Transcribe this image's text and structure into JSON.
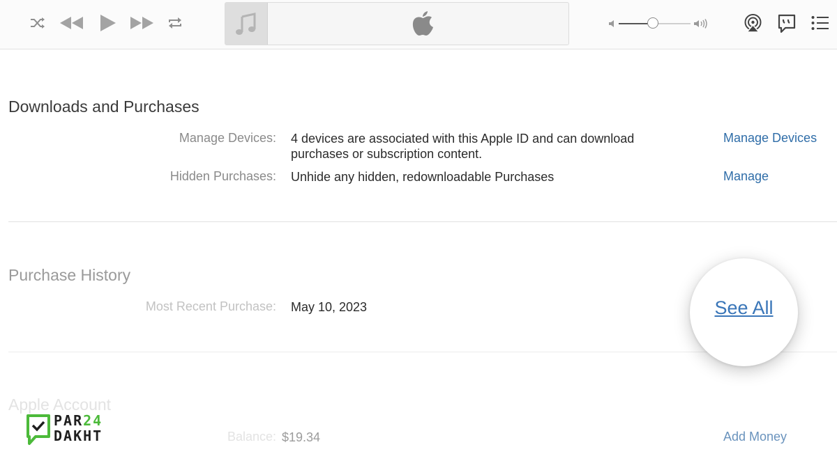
{
  "toolbar": {
    "icons": {
      "shuffle": "shuffle-icon",
      "previous": "rewind-icon",
      "play": "play-icon",
      "next": "fast-forward-icon",
      "repeat": "repeat-icon",
      "lcd_art": "music-note-icon",
      "lcd_logo": "apple-logo-icon",
      "volume_low": "volume-low-icon",
      "volume_high": "volume-high-icon",
      "airplay": "airplay-icon",
      "lyrics": "lyrics-icon",
      "queue": "list-icon"
    },
    "volume_level": 0.48
  },
  "downloads": {
    "title": "Downloads and Purchases",
    "manage_devices_label": "Manage Devices:",
    "manage_devices_line1": "4 devices are associated with this Apple ID and can download",
    "manage_devices_line2": "purchases or subscription content.",
    "manage_devices_link": "Manage Devices",
    "hidden_label": "Hidden Purchases:",
    "hidden_value": "Unhide any hidden, redownloadable Purchases",
    "hidden_link": "Manage"
  },
  "history": {
    "title": "Purchase History",
    "recent_label": "Most Recent Purchase:",
    "recent_value": "May 10, 2023",
    "see_all_link": "See All"
  },
  "account": {
    "title": "Apple Account",
    "balance_label": "Balance:",
    "balance_value": "$19.34",
    "add_money_link": "Add Money"
  },
  "watermark": {
    "line1_a": "PAR",
    "line1_b": "24",
    "line2": "DAKHT"
  },
  "colors": {
    "link": "#2f6da8",
    "brand_green": "#4cba3a"
  }
}
